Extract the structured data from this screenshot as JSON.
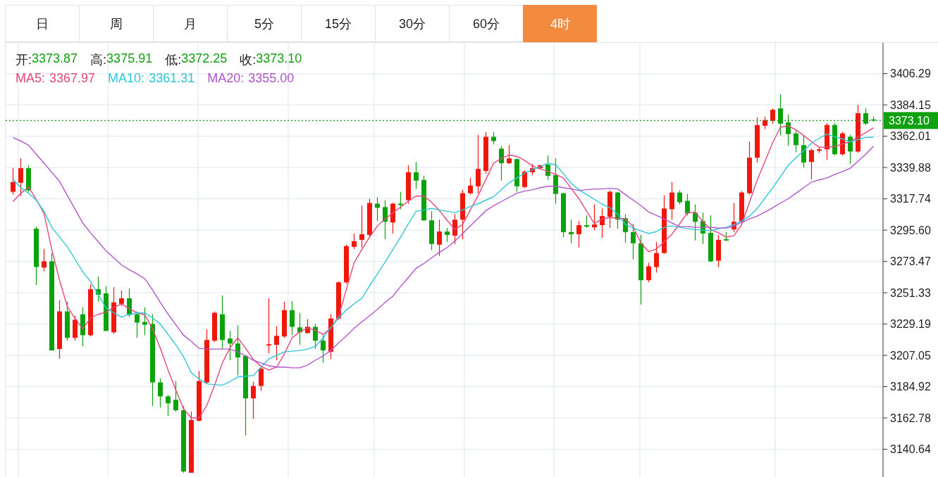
{
  "tabs": [
    {
      "label": "日",
      "selected": false
    },
    {
      "label": "周",
      "selected": false
    },
    {
      "label": "月",
      "selected": false
    },
    {
      "label": "5分",
      "selected": false
    },
    {
      "label": "15分",
      "selected": false
    },
    {
      "label": "30分",
      "selected": false
    },
    {
      "label": "60分",
      "selected": false
    },
    {
      "label": "4时",
      "selected": true
    }
  ],
  "ohlc": [
    {
      "label": "开:",
      "value": "3373.87"
    },
    {
      "label": "高:",
      "value": "3375.91"
    },
    {
      "label": "低:",
      "value": "3372.25"
    },
    {
      "label": "收:",
      "value": "3373.10"
    }
  ],
  "ma_legend": [
    {
      "value": "3367.97"
    },
    {
      "value": "3361.31"
    },
    {
      "value": "3355.00"
    }
  ],
  "chart_data": {
    "type": "candlestick",
    "ylim": [
      3122,
      3427
    ],
    "grid": true,
    "yticks": [
      {
        "value": 3406.29,
        "label": "3406.29"
      },
      {
        "value": 3384.15,
        "label": "3384.15"
      },
      {
        "value": 3362.01,
        "label": "3362.01"
      },
      {
        "value": 3339.88,
        "label": "3339.88"
      },
      {
        "value": 3317.74,
        "label": "3317.74"
      },
      {
        "value": 3295.6,
        "label": "3295.60"
      },
      {
        "value": 3273.47,
        "label": "3273.47"
      },
      {
        "value": 3251.33,
        "label": "3251.33"
      },
      {
        "value": 3229.19,
        "label": "3229.19"
      },
      {
        "value": 3207.05,
        "label": "3207.05"
      },
      {
        "value": 3184.92,
        "label": "3184.92"
      },
      {
        "value": 3162.78,
        "label": "3162.78"
      },
      {
        "value": 3140.64,
        "label": "3140.64"
      }
    ],
    "ref_lines": [
      {
        "axis": "y",
        "value": 3373.1,
        "label": "3373.10",
        "color": "#10a010"
      }
    ],
    "categories": [
      null,
      null,
      null,
      null,
      null,
      null,
      null,
      null,
      null,
      null,
      null,
      null,
      null,
      null,
      null,
      null,
      null,
      null,
      null,
      null,
      null,
      null,
      null,
      null,
      null,
      null,
      null,
      null,
      null,
      null,
      null,
      null,
      null,
      null,
      null,
      null,
      null,
      null,
      null,
      null,
      null,
      null,
      null,
      null,
      null,
      null,
      null,
      null,
      null,
      null,
      null,
      null,
      null,
      null,
      null,
      null,
      null,
      null,
      null,
      null,
      null,
      null,
      null,
      null,
      null,
      null,
      null,
      null,
      null,
      null,
      null,
      null,
      null,
      null,
      null,
      null,
      null,
      null,
      null,
      null,
      null,
      null,
      null,
      null,
      null,
      null,
      null,
      null,
      null,
      null,
      null,
      null,
      null,
      null,
      null,
      null,
      null,
      null,
      null,
      null,
      null,
      null,
      null,
      null,
      null,
      null,
      null,
      null,
      null,
      null,
      null,
      null
    ],
    "ohlc": [
      [
        3322.7,
        3339.4,
        3320.7,
        3329.6
      ],
      [
        3329.1,
        3346.3,
        3319.7,
        3339.4
      ],
      [
        3339.4,
        3341.4,
        3322.7,
        3323.7
      ],
      [
        3296.6,
        3298.1,
        3256.8,
        3269.5
      ],
      [
        3269.1,
        3282.3,
        3266.6,
        3273.5
      ],
      [
        3273.5,
        3279.4,
        3210.5,
        3210.5
      ],
      [
        3211.5,
        3245.9,
        3204.6,
        3238.1
      ],
      [
        3238.1,
        3245,
        3217.4,
        3219.4
      ],
      [
        3219.4,
        3235,
        3217.4,
        3232.2
      ],
      [
        3236.1,
        3241,
        3213.5,
        3221.3
      ],
      [
        3221.3,
        3257.3,
        3220.4,
        3253.8
      ],
      [
        3253.8,
        3262.7,
        3245,
        3249.9
      ],
      [
        3250.9,
        3255.8,
        3224.3,
        3224.3
      ],
      [
        3223.3,
        3255.3,
        3222.3,
        3244.5
      ],
      [
        3243.5,
        3252.8,
        3242,
        3247.4
      ],
      [
        3247.4,
        3254.3,
        3234.1,
        3235.6
      ],
      [
        3236.1,
        3238.1,
        3219.4,
        3230.2
      ],
      [
        3230.7,
        3241,
        3221.3,
        3228.7
      ],
      [
        3229.2,
        3236.1,
        3171.2,
        3187.9
      ],
      [
        3187.9,
        3190.8,
        3170.2,
        3178
      ],
      [
        3178,
        3179,
        3164.3,
        3173.1
      ],
      [
        3175.6,
        3188.8,
        3167.2,
        3168.2
      ],
      [
        3168.2,
        3171.2,
        3124,
        3124.9
      ],
      [
        3124,
        3167.2,
        3124,
        3161.3
      ],
      [
        3160.8,
        3195.8,
        3160.3,
        3188.8
      ],
      [
        3187.9,
        3225.3,
        3186.9,
        3217.9
      ],
      [
        3217.4,
        3238.1,
        3216.4,
        3237.1
      ],
      [
        3236.1,
        3249.4,
        3211.5,
        3217.9
      ],
      [
        3218.9,
        3224.3,
        3203.6,
        3215.4
      ],
      [
        3215.4,
        3228.2,
        3192.8,
        3205.6
      ],
      [
        3206.6,
        3207.6,
        3150.5,
        3176.6
      ],
      [
        3176.6,
        3188.4,
        3162.3,
        3185.4
      ],
      [
        3185.4,
        3198.7,
        3182,
        3197.7
      ],
      [
        3214,
        3247.4,
        3208.5,
        3214.9
      ],
      [
        3214.5,
        3227.7,
        3203.6,
        3220.8
      ],
      [
        3220.4,
        3245,
        3219.4,
        3239
      ],
      [
        3239,
        3245.5,
        3221.3,
        3227.2
      ],
      [
        3226.8,
        3237.1,
        3214.5,
        3223.3
      ],
      [
        3222.8,
        3232.7,
        3222.3,
        3227.2
      ],
      [
        3227.2,
        3229.2,
        3211.5,
        3217.4
      ],
      [
        3217.4,
        3221.3,
        3201.7,
        3210.5
      ],
      [
        3209.5,
        3236.1,
        3204.6,
        3233.1
      ],
      [
        3233.1,
        3259.2,
        3232.2,
        3258.7
      ],
      [
        3258.7,
        3285.3,
        3257.7,
        3284.3
      ],
      [
        3283.8,
        3293.2,
        3282.3,
        3287.8
      ],
      [
        3288.7,
        3312.9,
        3283.3,
        3292.7
      ],
      [
        3292.2,
        3317.8,
        3290.2,
        3314.8
      ],
      [
        3314.3,
        3318.8,
        3302,
        3311.4
      ],
      [
        3311.9,
        3316.8,
        3289.2,
        3301.5
      ],
      [
        3301,
        3314.8,
        3293.2,
        3314.3
      ],
      [
        3314.3,
        3322.7,
        3310.4,
        3313.3
      ],
      [
        3316.8,
        3341.4,
        3314.3,
        3336.5
      ],
      [
        3336.5,
        3343.8,
        3324.7,
        3330.6
      ],
      [
        3331.1,
        3334,
        3302,
        3302.5
      ],
      [
        3302.5,
        3308.9,
        3281.4,
        3285.8
      ],
      [
        3285.3,
        3303,
        3277.4,
        3294.6
      ],
      [
        3294.6,
        3297.1,
        3287.3,
        3292.2
      ],
      [
        3291.7,
        3306.9,
        3285.8,
        3303
      ],
      [
        3303,
        3324.2,
        3289.2,
        3321.7
      ],
      [
        3321.7,
        3332.5,
        3320.7,
        3327.1
      ],
      [
        3326.6,
        3363,
        3321.7,
        3338.9
      ],
      [
        3337.5,
        3365,
        3335.5,
        3361.6
      ],
      [
        3361.6,
        3365,
        3356.1,
        3358.6
      ],
      [
        3353.2,
        3355.2,
        3330.6,
        3342.9
      ],
      [
        3342.9,
        3355.7,
        3342.4,
        3346.3
      ],
      [
        3345.8,
        3346.3,
        3322.7,
        3326.6
      ],
      [
        3326.1,
        3338,
        3325.2,
        3337
      ],
      [
        3336.5,
        3342.4,
        3334.5,
        3339.4
      ],
      [
        3339.4,
        3341.9,
        3338.9,
        3341.4
      ],
      [
        3341.9,
        3348.3,
        3331.1,
        3334
      ],
      [
        3334.5,
        3346.3,
        3314.3,
        3321.2
      ],
      [
        3321.7,
        3321.7,
        3290.7,
        3294.2
      ],
      [
        3294.2,
        3303,
        3286.3,
        3292.7
      ],
      [
        3292.7,
        3302,
        3283.3,
        3299.1
      ],
      [
        3299.1,
        3306,
        3297.1,
        3298.1
      ],
      [
        3297.6,
        3313.8,
        3295.6,
        3299.6
      ],
      [
        3299.1,
        3310.9,
        3290.2,
        3305.5
      ],
      [
        3305,
        3323.7,
        3297.1,
        3322.7
      ],
      [
        3322.2,
        3322.7,
        3296.6,
        3303
      ],
      [
        3304,
        3306.9,
        3286.8,
        3294.2
      ],
      [
        3294.2,
        3300,
        3275,
        3286.3
      ],
      [
        3286.3,
        3292.2,
        3243,
        3260.2
      ],
      [
        3260.2,
        3272.5,
        3258.7,
        3270
      ],
      [
        3269.5,
        3287.3,
        3265.6,
        3279.4
      ],
      [
        3279.4,
        3320.2,
        3278.9,
        3310.9
      ],
      [
        3310.4,
        3329.6,
        3303,
        3322.2
      ],
      [
        3322.2,
        3323.7,
        3313.8,
        3315.3
      ],
      [
        3316.3,
        3321.2,
        3306,
        3307.4
      ],
      [
        3307.9,
        3313.8,
        3288.3,
        3301.5
      ],
      [
        3302,
        3307.9,
        3285.8,
        3293.2
      ],
      [
        3293.7,
        3306,
        3273,
        3273.5
      ],
      [
        3274,
        3292.2,
        3269.5,
        3288.7
      ],
      [
        3289.2,
        3294.2,
        3287.8,
        3288.3
      ],
      [
        3296.1,
        3314.8,
        3294.2,
        3301.5
      ],
      [
        3301.5,
        3323.2,
        3301,
        3322.2
      ],
      [
        3321.7,
        3358.1,
        3320.7,
        3346.8
      ],
      [
        3346.8,
        3375.3,
        3343.4,
        3369.9
      ],
      [
        3369.4,
        3375.8,
        3367,
        3373.4
      ],
      [
        3372.9,
        3381.7,
        3370.9,
        3380.7
      ],
      [
        3381.7,
        3391.6,
        3362.5,
        3370.9
      ],
      [
        3371.9,
        3377.3,
        3355.2,
        3363.5
      ],
      [
        3364,
        3366,
        3350.7,
        3355.7
      ],
      [
        3355.7,
        3362,
        3339.9,
        3343.4
      ],
      [
        3343.8,
        3353.2,
        3331.5,
        3352.2
      ],
      [
        3351.7,
        3354.2,
        3350.2,
        3352.7
      ],
      [
        3352.7,
        3371.4,
        3345.3,
        3369.9
      ],
      [
        3369.9,
        3371.4,
        3348.3,
        3349.3
      ],
      [
        3349.3,
        3365,
        3348.3,
        3364
      ],
      [
        3361.6,
        3363,
        3342.4,
        3351.2
      ],
      [
        3351.2,
        3384.2,
        3350.2,
        3378.3
      ],
      [
        3378.3,
        3381.7,
        3369.9,
        3370.9
      ],
      [
        3373.9,
        3375.9,
        3372.3,
        3373.1
      ]
    ],
    "series": [
      {
        "name": "MA5:",
        "type": "line",
        "color": "#e9457b",
        "values": [
          3315.8,
          3321.7,
          3326.1,
          3317.3,
          3307.4,
          3281.9,
          3260.2,
          3241.5,
          3233.1,
          3225.8,
          3233.6,
          3236.1,
          3237.6,
          3241,
          3243.5,
          3240,
          3237.1,
          3235.6,
          3225.8,
          3212,
          3196.7,
          3182.5,
          3169.2,
          3162.8,
          3162.8,
          3171.6,
          3185.9,
          3201.7,
          3212.5,
          3219.4,
          3212,
          3204.1,
          3199.2,
          3196.7,
          3198.7,
          3208.1,
          3219.4,
          3223.8,
          3226.3,
          3224.8,
          3221.8,
          3226.3,
          3234.6,
          3253.8,
          3272.5,
          3281.9,
          3290.7,
          3298.6,
          3303.5,
          3307.9,
          3311.9,
          3316.3,
          3319.7,
          3319.7,
          3315.3,
          3309.4,
          3302.5,
          3296.1,
          3299.6,
          3309.9,
          3320.2,
          3331.5,
          3342.9,
          3346.3,
          3348.8,
          3347.8,
          3344.8,
          3340.9,
          3338.9,
          3337,
          3335,
          3332.5,
          3325.2,
          3317.8,
          3308.9,
          3300.1,
          3303.5,
          3304.5,
          3304,
          3303.5,
          3298.1,
          3286.3,
          3280.4,
          3282.3,
          3287.3,
          3292.7,
          3300.1,
          3307.9,
          3308.4,
          3301.5,
          3296.1,
          3293.7,
          3290.7,
          3291.7,
          3299.6,
          3315.3,
          3331.1,
          3344.3,
          3357.6,
          3368.4,
          3369.4,
          3366.5,
          3362.5,
          3358.1,
          3354.2,
          3354.2,
          3354.7,
          3356.6,
          3358.1,
          3361.6,
          3364.5,
          3368
        ]
      },
      {
        "name": "MA10:",
        "type": "line",
        "color": "#2ec7d9",
        "values": [
          3331.5,
          3325.6,
          3321.7,
          3316.8,
          3308.9,
          3297.6,
          3290.7,
          3283.8,
          3275,
          3266.1,
          3259.2,
          3249.9,
          3240.5,
          3237.1,
          3234.1,
          3236.1,
          3237.1,
          3237.1,
          3233.6,
          3229.2,
          3221.8,
          3214.5,
          3206.1,
          3194.8,
          3190.3,
          3186.9,
          3186.4,
          3185.9,
          3188.4,
          3191.8,
          3192.3,
          3192.8,
          3198.7,
          3204.6,
          3207.1,
          3209.5,
          3210,
          3210.5,
          3211.5,
          3213.5,
          3219.4,
          3226.8,
          3233.6,
          3239.1,
          3243.5,
          3247.4,
          3256.3,
          3264.6,
          3273,
          3281.9,
          3290.7,
          3300.1,
          3308.9,
          3309.9,
          3310.9,
          3309.9,
          3308.9,
          3307.9,
          3309.9,
          3312.4,
          3314.3,
          3316.8,
          3319.2,
          3324.2,
          3329.1,
          3332.5,
          3336,
          3338.4,
          3340.4,
          3342.9,
          3341.9,
          3335.5,
          3328.6,
          3324.2,
          3320.7,
          3317.3,
          3313.8,
          3311.4,
          3306.9,
          3299.6,
          3297.1,
          3295.1,
          3293.2,
          3294.6,
          3297.6,
          3298.6,
          3297.6,
          3296.6,
          3296.1,
          3295.6,
          3295.1,
          3296.6,
          3297.6,
          3299.6,
          3302,
          3305.5,
          3310.9,
          3318.3,
          3325.6,
          3333.5,
          3341.4,
          3346.8,
          3351.7,
          3357.1,
          3360.6,
          3363.5,
          3361.6,
          3360.1,
          3358.1,
          3359.6,
          3361.1,
          3361.3
        ]
      },
      {
        "name": "MA20:",
        "type": "line",
        "color": "#b055cc",
        "values": [
          3361.1,
          3358.6,
          3355.7,
          3349.3,
          3342.9,
          3336.5,
          3330.1,
          3320.2,
          3310.4,
          3300.6,
          3293.7,
          3287.3,
          3280.9,
          3276,
          3271,
          3267.6,
          3264.6,
          3261.2,
          3253.3,
          3244.5,
          3236.1,
          3228.7,
          3221.3,
          3216.9,
          3212,
          3211.5,
          3211.5,
          3211.5,
          3211.5,
          3209.5,
          3206.6,
          3203.6,
          3201.7,
          3199.7,
          3198.7,
          3198.7,
          3198.2,
          3198.2,
          3200.2,
          3203.6,
          3206.6,
          3210.5,
          3215.9,
          3220.8,
          3226.3,
          3230.7,
          3235.1,
          3239.5,
          3244.5,
          3248.9,
          3255.8,
          3262.2,
          3268.6,
          3272,
          3276,
          3279.9,
          3283.3,
          3287.8,
          3293.2,
          3298.6,
          3304,
          3309.4,
          3312.9,
          3315.8,
          3318.8,
          3321.7,
          3323.2,
          3324.2,
          3325.6,
          3326.6,
          3326.6,
          3325.6,
          3324.7,
          3323.7,
          3324.2,
          3324.7,
          3324.7,
          3325.2,
          3324.7,
          3320.7,
          3316.8,
          3312.9,
          3308.4,
          3306,
          3303.5,
          3300.6,
          3298.1,
          3298.1,
          3297.6,
          3297.6,
          3297.6,
          3297.1,
          3297.1,
          3298.6,
          3301,
          3303.5,
          3305.5,
          3308.4,
          3311.4,
          3314.8,
          3317.8,
          3321.7,
          3325.6,
          3329.6,
          3331.1,
          3332.5,
          3335,
          3337,
          3339.4,
          3344.3,
          3349.3,
          3355
        ]
      }
    ]
  }
}
